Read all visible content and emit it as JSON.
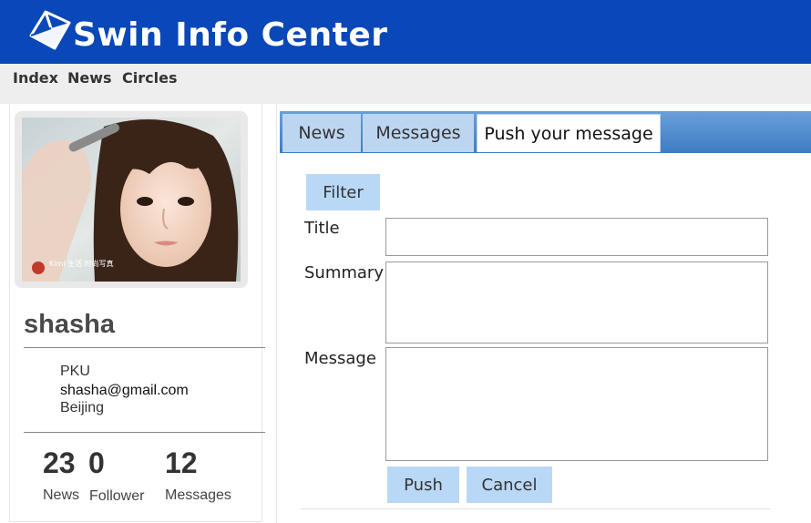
{
  "header": {
    "title": "Swin Info Center",
    "logo_icon": "cube-logo-icon",
    "background_color": "#0a47b8"
  },
  "nav": {
    "items": [
      "Index",
      "News",
      "Circles"
    ]
  },
  "profile": {
    "photo_icon": "profile-photo",
    "photo_caption": "Kimi 生活 时尚写真",
    "username": "shasha",
    "school": "PKU",
    "email": "shasha@gmail.com",
    "city": "Beijing",
    "stats": [
      {
        "value": "23",
        "label": "News"
      },
      {
        "value": "0",
        "label": "Follower"
      },
      {
        "value": "12",
        "label": "Messages"
      }
    ]
  },
  "tabs": {
    "items": [
      {
        "label": "News",
        "active": false
      },
      {
        "label": "Messages",
        "active": false
      },
      {
        "label": "Push your message",
        "active": true
      }
    ],
    "accent_color": "#3f7cc4",
    "inactive_color": "#bcd6f2"
  },
  "form": {
    "filter_label": "Filter",
    "title_label": "Title",
    "summary_label": "Summary",
    "message_label": "Message",
    "title_value": "",
    "summary_value": "",
    "message_value": "",
    "push_label": "Push",
    "cancel_label": "Cancel",
    "button_color": "#b9d8f6"
  }
}
